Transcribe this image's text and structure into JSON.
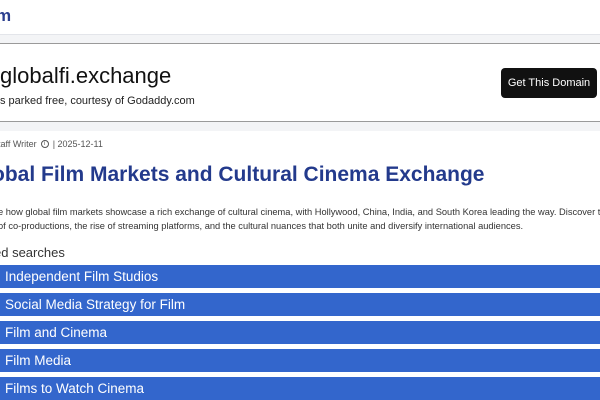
{
  "header": {
    "logo": "m"
  },
  "parked": {
    "domain": "globalfi.exchange",
    "courtesy": "s parked free, courtesy of Godaddy.com",
    "button": "Get This Domain"
  },
  "article": {
    "author": "taff Writer",
    "date": "| 2025-12-11",
    "title": "obal Film Markets and Cultural Cinema Exchange",
    "desc_line1": "e how global film markets showcase a rich exchange of cultural cinema, with Hollywood, China, India, and South Korea leading the way. Discover th",
    "desc_line2": " of co-productions, the rise of streaming platforms, and the cultural nuances that both unite and diversify international audiences."
  },
  "related": {
    "title": "ed searches",
    "items": [
      "Independent Film Studios",
      "Social Media Strategy for Film",
      "Film and Cinema",
      "Film Media",
      "Films to Watch Cinema"
    ]
  },
  "colors": {
    "accent": "#3366cc",
    "title": "#233a8c"
  }
}
